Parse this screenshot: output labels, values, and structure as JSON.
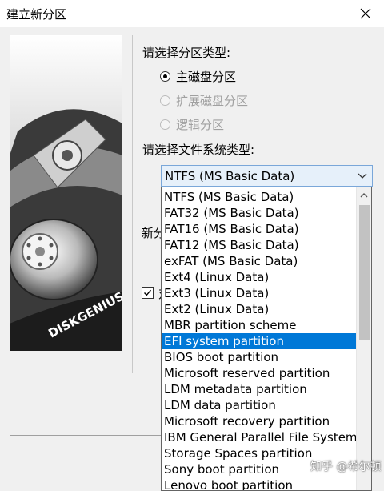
{
  "window": {
    "title": "建立新分区"
  },
  "partition_type": {
    "label": "请选择分区类型:",
    "options": [
      {
        "label": "主磁盘分区",
        "selected": true,
        "enabled": true
      },
      {
        "label": "扩展磁盘分区",
        "selected": false,
        "enabled": false
      },
      {
        "label": "逻辑分区",
        "selected": false,
        "enabled": false
      }
    ]
  },
  "filesystem": {
    "label": "请选择文件系统类型:",
    "selected_value": "NTFS (MS Basic Data)",
    "items": [
      "NTFS (MS Basic Data)",
      "FAT32 (MS Basic Data)",
      "FAT16 (MS Basic Data)",
      "FAT12 (MS Basic Data)",
      "exFAT (MS Basic Data)",
      "Ext4 (Linux Data)",
      "Ext3 (Linux Data)",
      "Ext2 (Linux Data)",
      "MBR partition scheme",
      "EFI system partition",
      "BIOS boot partition",
      "Microsoft reserved partition",
      "LDM metadata partition",
      "LDM data partition",
      "Microsoft recovery partition",
      "IBM General Parallel File System(GPFS)",
      "Storage Spaces partition",
      "Sony boot partition",
      "Lenovo boot partition"
    ],
    "highlighted_index": 9
  },
  "partially_visible": {
    "size_label": "新分",
    "checkbox_label": "对",
    "checkbox_checked": true
  },
  "branding": {
    "logo_text": "DISKGENIUS"
  },
  "watermark": "知乎 @希尔顿",
  "colors": {
    "accent": "#0078d7",
    "combo_bg": "#e6f0fa",
    "combo_border": "#7aa7d9"
  }
}
